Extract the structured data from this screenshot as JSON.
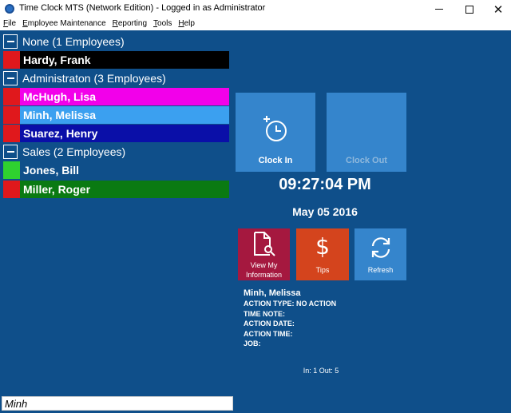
{
  "window": {
    "title": "Time Clock MTS (Network Edition)  - Logged in as Administrator",
    "minimize": "—",
    "close": "✕"
  },
  "menu": [
    {
      "label": "File",
      "u": "F",
      "rest": "ile"
    },
    {
      "label": "Employee Maintenance",
      "u": "E",
      "rest": "mployee Maintenance"
    },
    {
      "label": "Reporting",
      "u": "R",
      "rest": "eporting"
    },
    {
      "label": "Tools",
      "u": "T",
      "rest": "ools"
    },
    {
      "label": "Help",
      "u": "H",
      "rest": "elp"
    }
  ],
  "groups": [
    {
      "label": "None (1 Employees)",
      "employees": [
        {
          "name": "Hardy, Frank",
          "row_color": "#000000",
          "status_color": "#e0181c"
        }
      ]
    },
    {
      "label": "Administraton (3 Employees)",
      "employees": [
        {
          "name": "McHugh, Lisa",
          "row_color": "#f200ea",
          "status_color": "#e0181c"
        },
        {
          "name": "Minh, Melissa",
          "row_color": "#3ba0f0",
          "status_color": "#e0181c"
        },
        {
          "name": "Suarez, Henry",
          "row_color": "#0a0fa8",
          "status_color": "#e0181c"
        }
      ]
    },
    {
      "label": "Sales (2 Employees)",
      "employees": [
        {
          "name": "Jones, Bill",
          "row_color": "#0f4f8a",
          "status_color": "#2fd12f"
        },
        {
          "name": "Miller, Roger",
          "row_color": "#0a7a12",
          "status_color": "#e0181c"
        }
      ]
    }
  ],
  "actions": {
    "clock_in": "Clock In",
    "clock_out": "Clock Out",
    "view_info": "View My Information",
    "tips": "Tips",
    "refresh": "Refresh"
  },
  "clock": {
    "time": "09:27:04 PM",
    "date": "May 05 2016"
  },
  "info": {
    "name": "Minh, Melissa",
    "action_type": "ACTION TYPE: NO ACTION",
    "time_note": "TIME NOTE:",
    "action_date": "ACTION DATE:",
    "action_time": "ACTION TIME:",
    "job": "JOB:"
  },
  "status": {
    "in_out": "In: 1  Out: 5"
  },
  "search": {
    "value": "Minh"
  },
  "colors": {
    "background": "#0f4f8a",
    "tile_blue": "#3585cc",
    "tile_view_info": "#a5183f",
    "tile_tips": "#d4441d",
    "clock_out_text": "#8fb8dc"
  }
}
